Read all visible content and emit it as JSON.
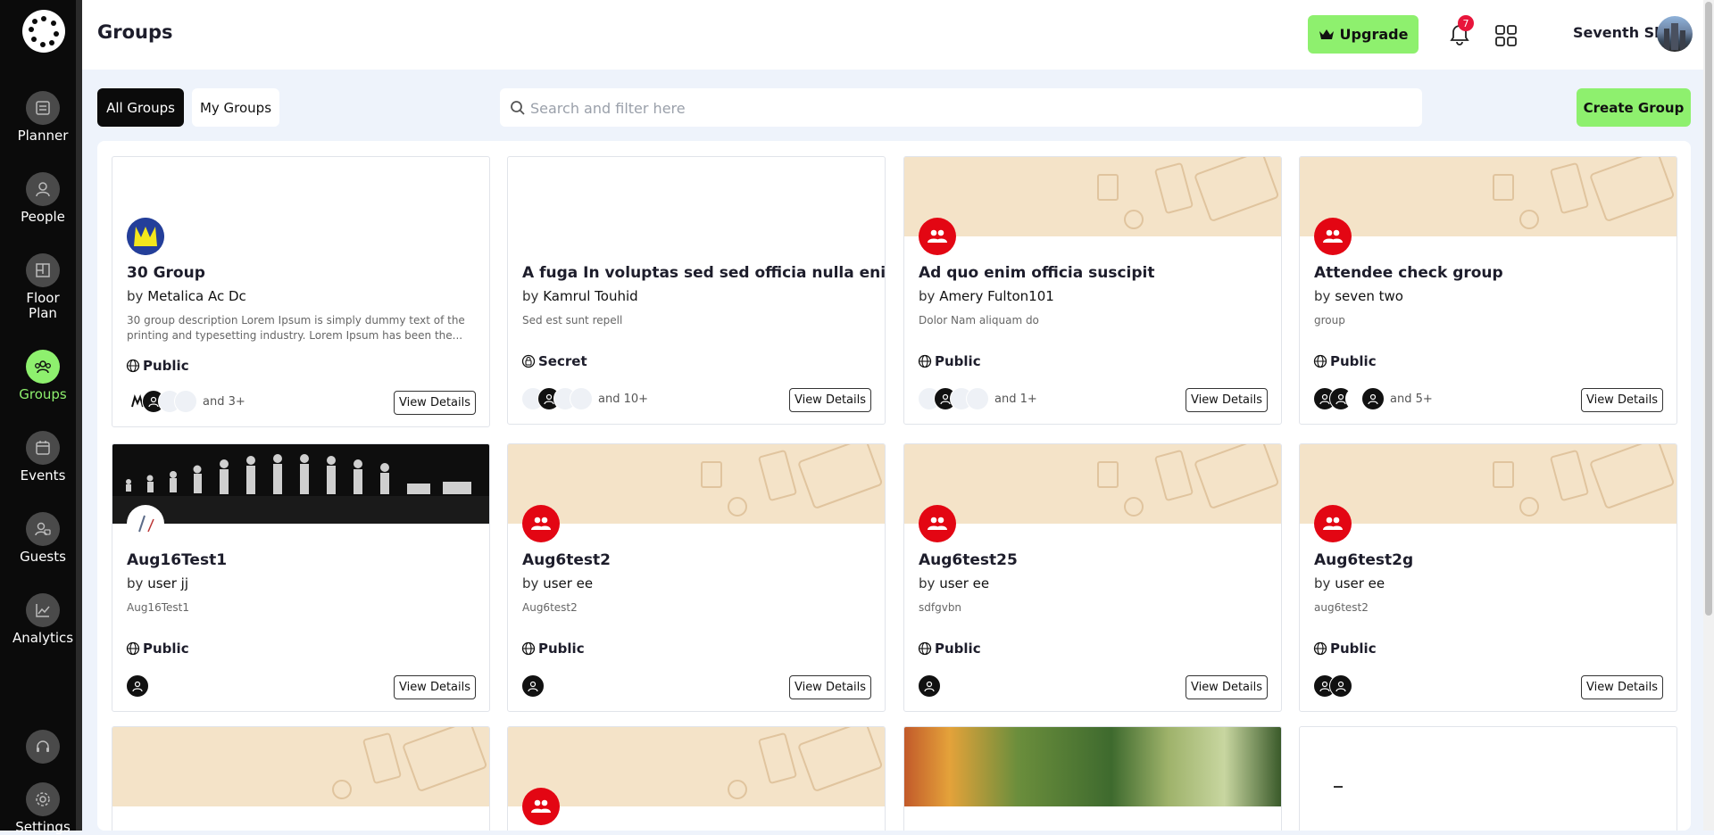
{
  "header": {
    "title": "Groups",
    "upgrade_label": "Upgrade",
    "notification_count": "7",
    "user_name": "Seventh Sky"
  },
  "sidebar": {
    "items": [
      {
        "label": "Planner",
        "icon": "planner-icon"
      },
      {
        "label": "People",
        "icon": "person-icon"
      },
      {
        "label": "Floor Plan",
        "icon": "floor-plan-icon"
      },
      {
        "label": "Groups",
        "icon": "groups-icon"
      },
      {
        "label": "Events",
        "icon": "calendar-icon"
      },
      {
        "label": "Guests",
        "icon": "guests-icon"
      },
      {
        "label": "Analytics",
        "icon": "chart-icon"
      },
      {
        "label": "Settings",
        "icon": "gear-icon"
      }
    ]
  },
  "toolbar": {
    "tab_all": "All Groups",
    "tab_my": "My Groups",
    "search_placeholder": "Search and filter here",
    "create_label": "Create Group"
  },
  "colors": {
    "accent": "#8ef06e",
    "group_icon": "#e30613",
    "badge": "#e8153b"
  },
  "cards": [
    {
      "title": "30 Group",
      "by": "by",
      "author": "Metalica Ac Dc",
      "desc": "30 group description Lorem Ipsum is simply dummy text of the printing and typesetting industry. Lorem Ipsum has been the...",
      "privacy": "Public",
      "more": "and 3+",
      "view": "View Details"
    },
    {
      "title": "A fuga In voluptas sed sed officia nulla enim",
      "by": "by",
      "author": "Kamrul Touhid",
      "desc": "Sed est sunt repell",
      "privacy": "Secret",
      "more": "and 10+",
      "view": "View Details"
    },
    {
      "title": "Ad quo enim officia suscipit",
      "by": "by",
      "author": "Amery Fulton101",
      "desc": "Dolor Nam aliquam do",
      "privacy": "Public",
      "more": "and 1+",
      "view": "View Details"
    },
    {
      "title": "Attendee check group",
      "by": "by",
      "author": "seven two",
      "desc": "group",
      "privacy": "Public",
      "more": "and 5+",
      "view": "View Details"
    },
    {
      "title": "Aug16Test1",
      "by": "by",
      "author": "user jj",
      "desc": "Aug16Test1",
      "privacy": "Public",
      "more": "",
      "view": "View Details"
    },
    {
      "title": "Aug6test2",
      "by": "by",
      "author": "user ee",
      "desc": "Aug6test2",
      "privacy": "Public",
      "more": "",
      "view": "View Details"
    },
    {
      "title": "Aug6test25",
      "by": "by",
      "author": "user ee",
      "desc": "sdfgvbn",
      "privacy": "Public",
      "more": "",
      "view": "View Details"
    },
    {
      "title": "Aug6test2g",
      "by": "by",
      "author": "user ee",
      "desc": "aug6test2",
      "privacy": "Public",
      "more": "",
      "view": "View Details"
    }
  ]
}
